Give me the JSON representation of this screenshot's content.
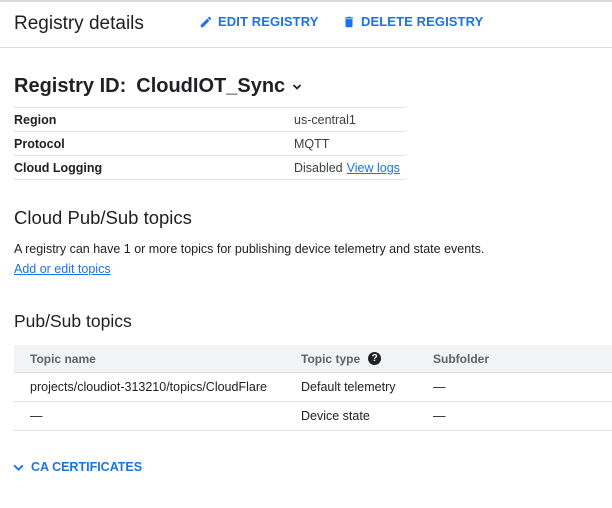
{
  "header": {
    "title": "Registry details",
    "edit_label": "EDIT REGISTRY",
    "delete_label": "DELETE REGISTRY"
  },
  "registry": {
    "id_label": "Registry ID:",
    "id_value": "CloudIOT_Sync",
    "properties": [
      {
        "key": "Region",
        "value": "us-central1"
      },
      {
        "key": "Protocol",
        "value": "MQTT"
      },
      {
        "key": "Cloud Logging",
        "value": "Disabled",
        "link": "View logs"
      }
    ]
  },
  "pubsub": {
    "heading": "Cloud Pub/Sub topics",
    "description": "A registry can have 1 or more topics for publishing device telemetry and state events.",
    "add_link": "Add or edit topics"
  },
  "topics": {
    "heading": "Pub/Sub topics",
    "columns": [
      "Topic name",
      "Topic type",
      "Subfolder"
    ],
    "rows": [
      [
        "projects/cloudiot-313210/topics/CloudFlare",
        "Default telemetry",
        "—"
      ],
      [
        "—",
        "Device state",
        "—"
      ]
    ]
  },
  "ca": {
    "label": "CA CERTIFICATES"
  },
  "colors": {
    "accent": "#1a73e8",
    "text": "#202124",
    "divider": "#e0e0e0",
    "table_header_bg": "#f1f3f4"
  },
  "icons": [
    "pencil-icon",
    "trash-icon",
    "chevron-down-icon",
    "help-icon"
  ]
}
